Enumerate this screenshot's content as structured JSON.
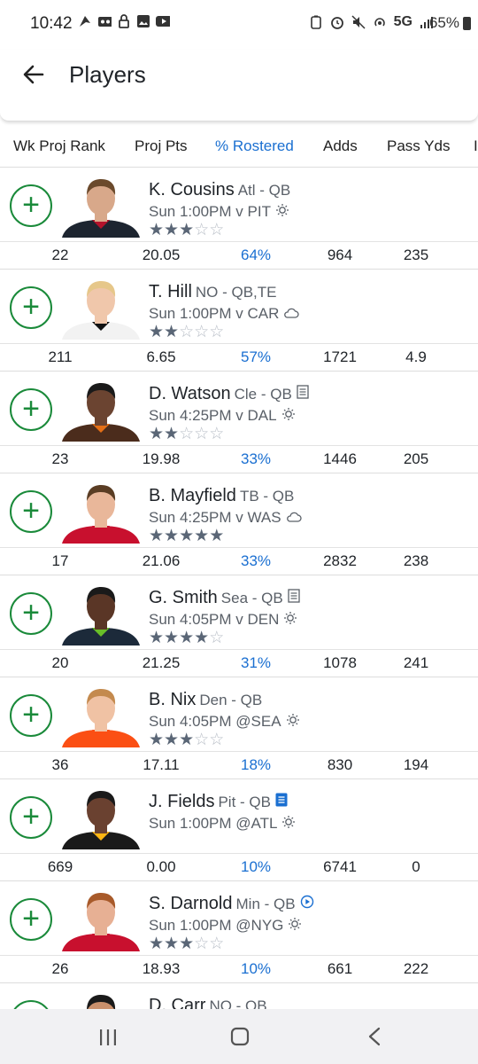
{
  "status": {
    "time": "10:42",
    "network": "5G",
    "battery": "65%"
  },
  "header": {
    "title": "Players"
  },
  "columns": [
    "Wk Proj Rank",
    "Proj Pts",
    "% Rostered",
    "Adds",
    "Pass Yds"
  ],
  "active_column": "% Rostered",
  "players": [
    {
      "name": "K. Cousins",
      "team_pos": "Atl - QB",
      "game": "Sun 1:00PM v PIT",
      "weather": "sun-icon",
      "note": "",
      "rating": 3,
      "wk_proj_rank": "22",
      "proj_pts": "20.05",
      "rostered": "64%",
      "adds": "964",
      "pass_yds": "235",
      "jersey": "#1d2530",
      "accent": "#b3132b",
      "skin": "#d8a88a",
      "hair": "#6b4a2c"
    },
    {
      "name": "T. Hill",
      "team_pos": "NO - QB,TE",
      "game": "Sun 1:00PM v CAR",
      "weather": "cloud-icon",
      "note": "",
      "rating": 2,
      "wk_proj_rank": "211",
      "proj_pts": "6.65",
      "rostered": "57%",
      "adds": "1721",
      "pass_yds": "4.9",
      "jersey": "#f2f2f2",
      "accent": "#111111",
      "skin": "#f0c7ab",
      "hair": "#e6c78a"
    },
    {
      "name": "D. Watson",
      "team_pos": "Cle - QB",
      "game": "Sun 4:25PM v DAL",
      "weather": "sun-icon",
      "note": "news-icon",
      "rating": 2,
      "wk_proj_rank": "23",
      "proj_pts": "19.98",
      "rostered": "33%",
      "adds": "1446",
      "pass_yds": "205",
      "jersey": "#4b2c1c",
      "accent": "#e46f16",
      "skin": "#6b4431",
      "hair": "#1a1a1a"
    },
    {
      "name": "B. Mayfield",
      "team_pos": "TB - QB",
      "game": "Sun 4:25PM v WAS",
      "weather": "cloud-icon",
      "note": "",
      "rating": 5,
      "wk_proj_rank": "17",
      "proj_pts": "21.06",
      "rostered": "33%",
      "adds": "2832",
      "pass_yds": "238",
      "jersey": "#c8102e",
      "accent": "#c8102e",
      "skin": "#e9b79a",
      "hair": "#5a3d24"
    },
    {
      "name": "G. Smith",
      "team_pos": "Sea - QB",
      "game": "Sun 4:05PM v DEN",
      "weather": "sun-icon",
      "note": "news-icon",
      "rating": 4,
      "wk_proj_rank": "20",
      "proj_pts": "21.25",
      "rostered": "31%",
      "adds": "1078",
      "pass_yds": "241",
      "jersey": "#1c2a3a",
      "accent": "#69be28",
      "skin": "#5a3626",
      "hair": "#1a1a1a"
    },
    {
      "name": "B. Nix",
      "team_pos": "Den - QB",
      "game": "Sun 4:05PM @SEA",
      "weather": "sun-icon",
      "note": "",
      "rating": 3,
      "wk_proj_rank": "36",
      "proj_pts": "17.11",
      "rostered": "18%",
      "adds": "830",
      "pass_yds": "194",
      "jersey": "#fb4f14",
      "accent": "#fb4f14",
      "skin": "#f0c2a4",
      "hair": "#c48a4e"
    },
    {
      "name": "J. Fields",
      "team_pos": "Pit - QB",
      "game": "Sun 1:00PM @ATL",
      "weather": "sun-icon",
      "note": "news-blue-icon",
      "rating": 0,
      "wk_proj_rank": "669",
      "proj_pts": "0.00",
      "rostered": "10%",
      "adds": "6741",
      "pass_yds": "0",
      "jersey": "#1a1a1a",
      "accent": "#ffb612",
      "skin": "#6a4130",
      "hair": "#1a1a1a"
    },
    {
      "name": "S. Darnold",
      "team_pos": "Min - QB",
      "game": "Sun 1:00PM @NYG",
      "weather": "sun-icon",
      "note": "play-icon",
      "rating": 3,
      "wk_proj_rank": "26",
      "proj_pts": "18.93",
      "rostered": "10%",
      "adds": "661",
      "pass_yds": "222",
      "jersey": "#c8102e",
      "accent": "#c8102e",
      "skin": "#e7b094",
      "hair": "#a85a2a"
    },
    {
      "name": "D. Carr",
      "team_pos": "NO - QB",
      "game": "",
      "weather": "",
      "note": "",
      "rating": 0,
      "wk_proj_rank": "",
      "proj_pts": "",
      "rostered": "",
      "adds": "",
      "pass_yds": "",
      "jersey": "#111111",
      "accent": "#111111",
      "skin": "#c9906c",
      "hair": "#1a1a1a"
    }
  ]
}
